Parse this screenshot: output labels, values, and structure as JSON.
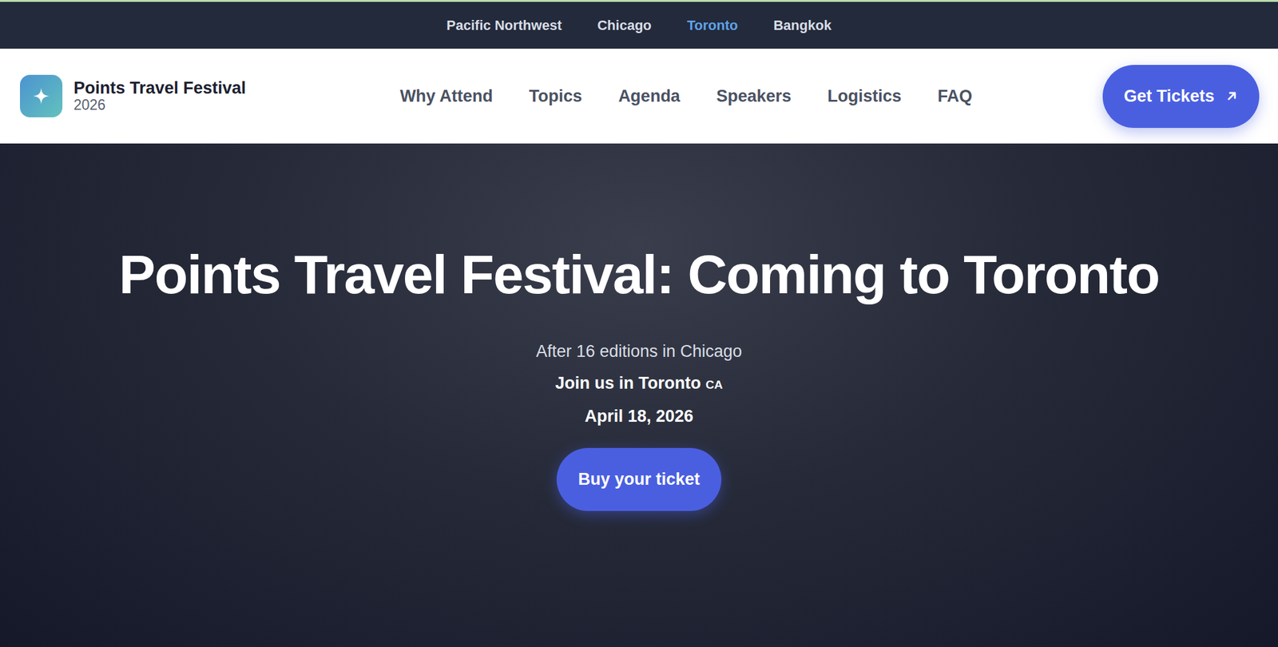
{
  "topbar": {
    "locations": [
      {
        "label": "Pacific Northwest",
        "selected": false
      },
      {
        "label": "Chicago",
        "selected": false
      },
      {
        "label": "Toronto",
        "selected": true
      },
      {
        "label": "Bangkok",
        "selected": false
      }
    ]
  },
  "header": {
    "logo": {
      "title": "Points Travel Festival",
      "year": "2026"
    },
    "nav": [
      "Why Attend",
      "Topics",
      "Agenda",
      "Speakers",
      "Logistics",
      "FAQ"
    ],
    "cta": "Get Tickets"
  },
  "hero": {
    "title": "Points Travel Festival: Coming to Toronto",
    "subtitle": "After 16 editions in Chicago",
    "location": "Join us in Toronto",
    "country": "CA",
    "date": "April 18, 2026",
    "button": "Buy your ticket"
  }
}
